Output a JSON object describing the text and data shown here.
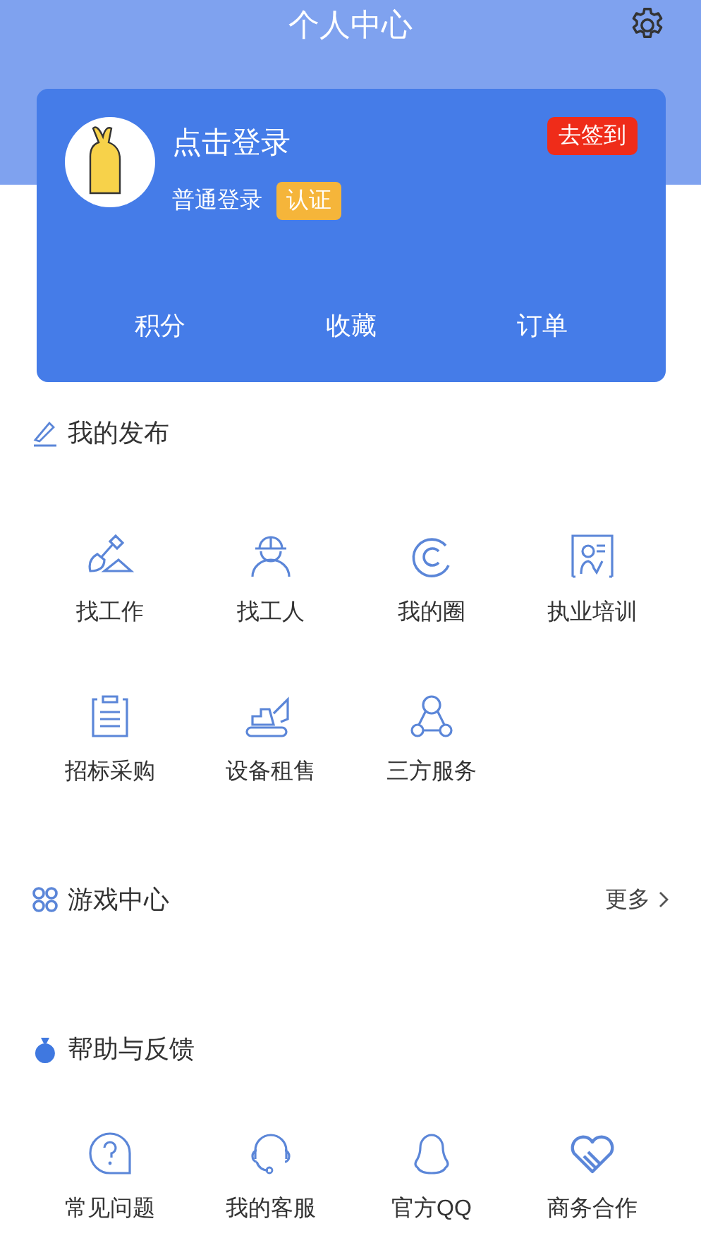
{
  "header": {
    "title": "个人中心"
  },
  "profile": {
    "name": "点击登录",
    "login_type": "普通登录",
    "badge": "认证",
    "checkin_button": "去签到",
    "stats": [
      "积分",
      "收藏",
      "订单"
    ]
  },
  "sections": [
    {
      "title": "我的发布",
      "items": [
        "找工作",
        "找工人",
        "我的圈",
        "执业培训",
        "招标采购",
        "设备租售",
        "三方服务"
      ]
    },
    {
      "title": "游戏中心",
      "more": "更多"
    },
    {
      "title": "帮助与反馈",
      "items": [
        "常见问题",
        "我的客服",
        "官方QQ",
        "商务合作"
      ]
    }
  ]
}
